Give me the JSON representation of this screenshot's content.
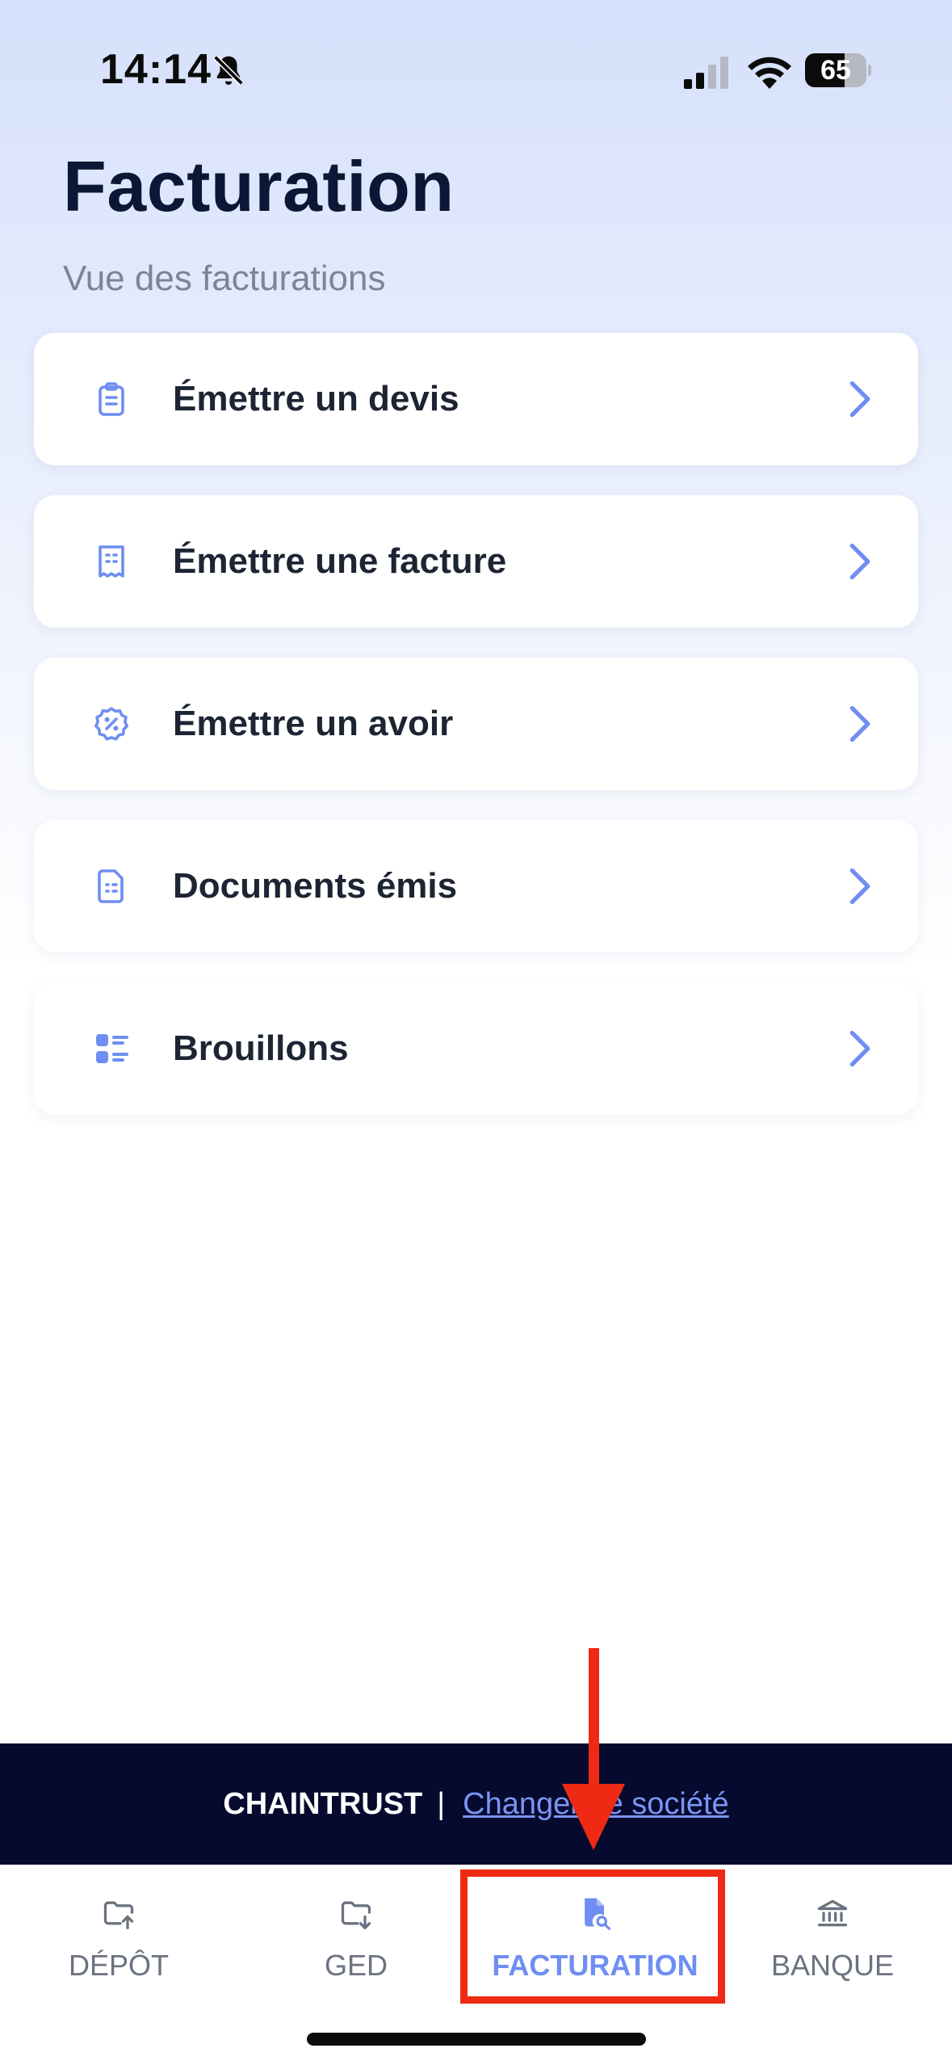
{
  "status_bar": {
    "time": "14:14",
    "battery": "65",
    "battery_level": 0.65
  },
  "header": {
    "title": "Facturation",
    "subtitle": "Vue des facturations"
  },
  "menu": {
    "items": [
      {
        "label": "Émettre un devis",
        "icon": "clipboard-icon"
      },
      {
        "label": "Émettre une facture",
        "icon": "receipt-icon"
      },
      {
        "label": "Émettre un avoir",
        "icon": "discount-badge-icon"
      },
      {
        "label": "Documents émis",
        "icon": "document-icon"
      },
      {
        "label": "Brouillons",
        "icon": "list-icon"
      }
    ]
  },
  "company_bar": {
    "company": "CHAINTRUST",
    "separator": "|",
    "change_link": "Changer de société"
  },
  "tabs": [
    {
      "label": "DÉPÔT",
      "icon": "folder-upload-icon",
      "active": false
    },
    {
      "label": "GED",
      "icon": "folder-download-icon",
      "active": false
    },
    {
      "label": "FACTURATION",
      "icon": "invoice-search-icon",
      "active": true
    },
    {
      "label": "BANQUE",
      "icon": "bank-icon",
      "active": false
    }
  ],
  "colors": {
    "accent": "#6f8ef2",
    "title": "#0c1736",
    "company_bar_bg": "#060a2e",
    "highlight": "#ee2a14"
  }
}
